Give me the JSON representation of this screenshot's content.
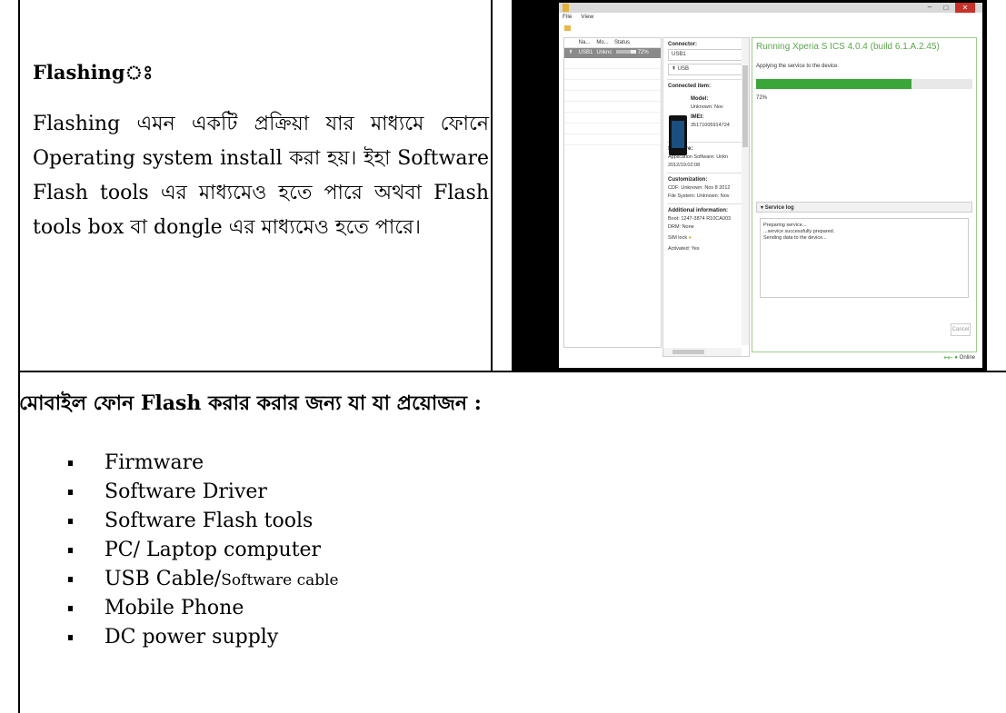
{
  "left_cell": {
    "title": "Flashingঃ",
    "paragraph": "Flashing এমন একটি প্রক্রিয়া যার মাধ্যমে ফোনে Operating system install করা হয়। ইহা Software Flash tools এর মাধ্যমেও হতে পারে অথবা Flash tools box বা dongle এর মাধ্যমেও হতে পারে।"
  },
  "screenshot": {
    "menu": [
      "File",
      "View"
    ],
    "device_list": {
      "columns": [
        "Na...",
        "Mo...",
        "Status"
      ],
      "row": {
        "name": "USB1",
        "model": "Unknc",
        "progress_label": "72%",
        "progress": 0.72
      }
    },
    "details": {
      "connector_label": "Connector:",
      "connector_value": "USB1",
      "usb_label": "USB",
      "connected_label": "Connected item:",
      "model_label": "Model:",
      "model_value": "Unknown: Nov",
      "imei_label": "IMEI:",
      "imei_value": "35171005914724",
      "software_label": "Software:",
      "software_value_1": "Application Software: Unkn",
      "software_value_2": "2012/19:02:08",
      "custom_label": "Customization:",
      "custom_value_1": "CDF: Unknown: Nov 8 2012",
      "custom_value_2": "File System: Unknown: Nov",
      "additional_label": "Additional information:",
      "boot_value": "Boot: 1247-3874 R10CA003",
      "drm_value": "DRM: None",
      "simlock_value": "SIM lock",
      "activated_value": "Activated: Yes"
    },
    "right_panel": {
      "title": "Running Xperia S ICS 4.0.4 (build 6.1.A.2.45)",
      "subtitle": "Applying the service to the device.",
      "progress": 0.72,
      "progress_label": "72%",
      "log_title": "Service log",
      "log_lines": [
        "Preparing service...",
        "...service successfully prepared.",
        "Sending data to the device..."
      ],
      "cancel": "Cancel",
      "status": "Online"
    },
    "colors": {
      "progress_green": "#3aa63a",
      "title_green": "#5aa64a",
      "close_red": "#c7312a"
    }
  },
  "requirements": {
    "title": "মোবাইল ফোন Flash  করার করার জন্য যা যা প্রয়োজন :",
    "items": [
      {
        "text": "Firmware"
      },
      {
        "text": "Software Driver"
      },
      {
        "text": "Software Flash tools"
      },
      {
        "text": "PC/ Laptop computer"
      },
      {
        "text": "USB Cable/",
        "small": "Software cable"
      },
      {
        "text": "Mobile Phone"
      },
      {
        "text": "DC power supply"
      }
    ]
  }
}
